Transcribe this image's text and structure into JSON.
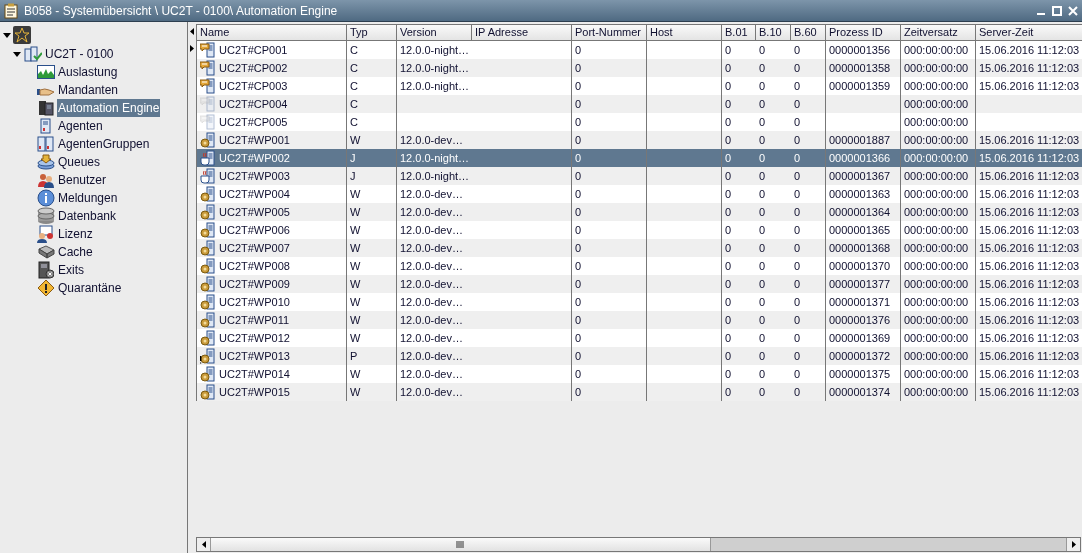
{
  "window": {
    "title": "B058 - Systemübersicht \\ UC2T - 0100\\ Automation Engine"
  },
  "tree": {
    "expanded": true,
    "children": [
      {
        "label": "UC2T - 0100",
        "expanded": true,
        "children": [
          {
            "label": "Auslastung",
            "selected": false
          },
          {
            "label": "Mandanten",
            "selected": false
          },
          {
            "label": "Automation Engine",
            "selected": true
          },
          {
            "label": "Agenten",
            "selected": false
          },
          {
            "label": "AgentenGruppen",
            "selected": false
          },
          {
            "label": "Queues",
            "selected": false
          },
          {
            "label": "Benutzer",
            "selected": false
          },
          {
            "label": "Meldungen",
            "selected": false
          },
          {
            "label": "Datenbank",
            "selected": false
          },
          {
            "label": "Lizenz",
            "selected": false
          },
          {
            "label": "Cache",
            "selected": false
          },
          {
            "label": "Exits",
            "selected": false
          },
          {
            "label": "Quarantäne",
            "selected": false
          }
        ]
      }
    ]
  },
  "table": {
    "columns": [
      "Name",
      "Typ",
      "Version",
      "IP Adresse",
      "Port-Nummer",
      "Host",
      "B.01",
      "B.10",
      "B.60",
      "Prozess ID",
      "Zeitversatz",
      "Server-Zeit"
    ],
    "rows": [
      {
        "kind": "cp",
        "active": true,
        "selected": false,
        "cells": [
          "UC2T#CP001",
          "C",
          "12.0.0-night…",
          "",
          "0",
          "",
          "0",
          "0",
          "0",
          "0000001356",
          "000:00:00:00",
          "15.06.2016 11:12:03"
        ]
      },
      {
        "kind": "cp",
        "active": true,
        "selected": false,
        "cells": [
          "UC2T#CP002",
          "C",
          "12.0.0-night…",
          "",
          "0",
          "",
          "0",
          "0",
          "0",
          "0000001358",
          "000:00:00:00",
          "15.06.2016 11:12:03"
        ]
      },
      {
        "kind": "cp",
        "active": true,
        "selected": false,
        "cells": [
          "UC2T#CP003",
          "C",
          "12.0.0-night…",
          "",
          "0",
          "",
          "0",
          "0",
          "0",
          "0000001359",
          "000:00:00:00",
          "15.06.2016 11:12:03"
        ]
      },
      {
        "kind": "cp",
        "active": false,
        "selected": false,
        "cells": [
          "UC2T#CP004",
          "C",
          "",
          "",
          "0",
          "",
          "0",
          "0",
          "0",
          "",
          "000:00:00:00",
          ""
        ]
      },
      {
        "kind": "cp",
        "active": false,
        "selected": false,
        "cells": [
          "UC2T#CP005",
          "C",
          "",
          "",
          "0",
          "",
          "0",
          "0",
          "0",
          "",
          "000:00:00:00",
          ""
        ]
      },
      {
        "kind": "wp",
        "active": true,
        "selected": false,
        "cells": [
          "UC2T#WP001",
          "W",
          "12.0.0-dev…",
          "",
          "0",
          "",
          "0",
          "0",
          "0",
          "0000001887",
          "000:00:00:00",
          "15.06.2016 11:12:03"
        ]
      },
      {
        "kind": "java",
        "active": true,
        "selected": true,
        "cells": [
          "UC2T#WP002",
          "J",
          "12.0.0-night…",
          "",
          "0",
          "",
          "0",
          "0",
          "0",
          "0000001366",
          "000:00:00:00",
          "15.06.2016 11:12:03"
        ]
      },
      {
        "kind": "java",
        "active": true,
        "selected": false,
        "cells": [
          "UC2T#WP003",
          "J",
          "12.0.0-night…",
          "",
          "0",
          "",
          "0",
          "0",
          "0",
          "0000001367",
          "000:00:00:00",
          "15.06.2016 11:12:03"
        ]
      },
      {
        "kind": "wp",
        "active": true,
        "selected": false,
        "cells": [
          "UC2T#WP004",
          "W",
          "12.0.0-dev…",
          "",
          "0",
          "",
          "0",
          "0",
          "0",
          "0000001363",
          "000:00:00:00",
          "15.06.2016 11:12:03"
        ]
      },
      {
        "kind": "wp",
        "active": true,
        "selected": false,
        "cells": [
          "UC2T#WP005",
          "W",
          "12.0.0-dev…",
          "",
          "0",
          "",
          "0",
          "0",
          "0",
          "0000001364",
          "000:00:00:00",
          "15.06.2016 11:12:03"
        ]
      },
      {
        "kind": "wp",
        "active": true,
        "selected": false,
        "cells": [
          "UC2T#WP006",
          "W",
          "12.0.0-dev…",
          "",
          "0",
          "",
          "0",
          "0",
          "0",
          "0000001365",
          "000:00:00:00",
          "15.06.2016 11:12:03"
        ]
      },
      {
        "kind": "wp",
        "active": true,
        "selected": false,
        "cells": [
          "UC2T#WP007",
          "W",
          "12.0.0-dev…",
          "",
          "0",
          "",
          "0",
          "0",
          "0",
          "0000001368",
          "000:00:00:00",
          "15.06.2016 11:12:03"
        ]
      },
      {
        "kind": "wp",
        "active": true,
        "selected": false,
        "cells": [
          "UC2T#WP008",
          "W",
          "12.0.0-dev…",
          "",
          "0",
          "",
          "0",
          "0",
          "0",
          "0000001370",
          "000:00:00:00",
          "15.06.2016 11:12:03"
        ]
      },
      {
        "kind": "wp",
        "active": true,
        "selected": false,
        "cells": [
          "UC2T#WP009",
          "W",
          "12.0.0-dev…",
          "",
          "0",
          "",
          "0",
          "0",
          "0",
          "0000001377",
          "000:00:00:00",
          "15.06.2016 11:12:03"
        ]
      },
      {
        "kind": "wp",
        "active": true,
        "selected": false,
        "cells": [
          "UC2T#WP010",
          "W",
          "12.0.0-dev…",
          "",
          "0",
          "",
          "0",
          "0",
          "0",
          "0000001371",
          "000:00:00:00",
          "15.06.2016 11:12:03"
        ]
      },
      {
        "kind": "wp",
        "active": true,
        "selected": false,
        "cells": [
          "UC2T#WP011",
          "W",
          "12.0.0-dev…",
          "",
          "0",
          "",
          "0",
          "0",
          "0",
          "0000001376",
          "000:00:00:00",
          "15.06.2016 11:12:03"
        ]
      },
      {
        "kind": "wp",
        "active": true,
        "selected": false,
        "cells": [
          "UC2T#WP012",
          "W",
          "12.0.0-dev…",
          "",
          "0",
          "",
          "0",
          "0",
          "0",
          "0000001369",
          "000:00:00:00",
          "15.06.2016 11:12:03"
        ]
      },
      {
        "kind": "wp_warning",
        "active": true,
        "selected": false,
        "cells": [
          "UC2T#WP013",
          "P",
          "12.0.0-dev…",
          "",
          "0",
          "",
          "0",
          "0",
          "0",
          "0000001372",
          "000:00:00:00",
          "15.06.2016 11:12:03"
        ]
      },
      {
        "kind": "wp",
        "active": true,
        "selected": false,
        "cells": [
          "UC2T#WP014",
          "W",
          "12.0.0-dev…",
          "",
          "0",
          "",
          "0",
          "0",
          "0",
          "0000001375",
          "000:00:00:00",
          "15.06.2016 11:12:03"
        ]
      },
      {
        "kind": "wp",
        "active": true,
        "selected": false,
        "cells": [
          "UC2T#WP015",
          "W",
          "12.0.0-dev…",
          "",
          "0",
          "",
          "0",
          "0",
          "0",
          "0000001374",
          "000:00:00:00",
          "15.06.2016 11:12:03"
        ]
      }
    ]
  }
}
